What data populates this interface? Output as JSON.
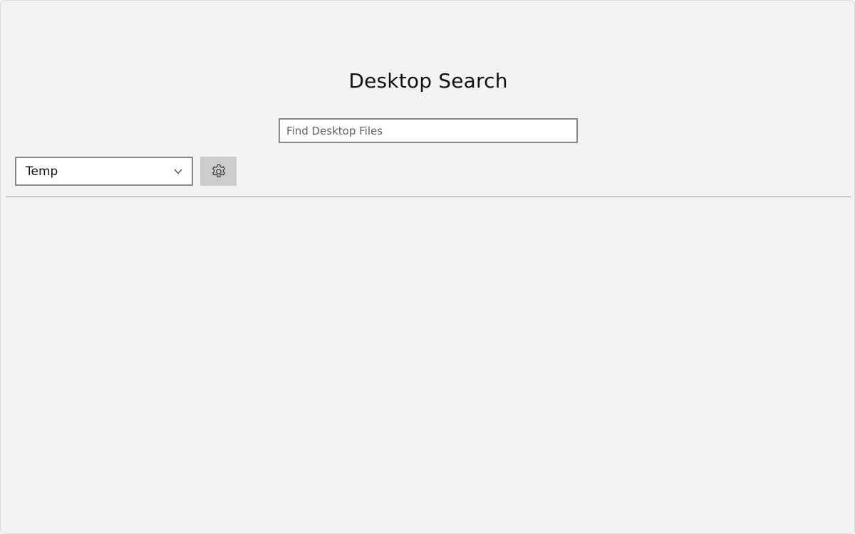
{
  "app": {
    "title": "Desktop Search"
  },
  "search": {
    "placeholder": "Find Desktop Files",
    "value": ""
  },
  "location": {
    "selected": "Temp"
  },
  "icons": {
    "settings": "gear-icon",
    "dropdown": "chevron-down-icon"
  },
  "colors": {
    "background": "#f3f3f3",
    "settings_button": "#cccccc",
    "border": "#8a8a8a"
  }
}
